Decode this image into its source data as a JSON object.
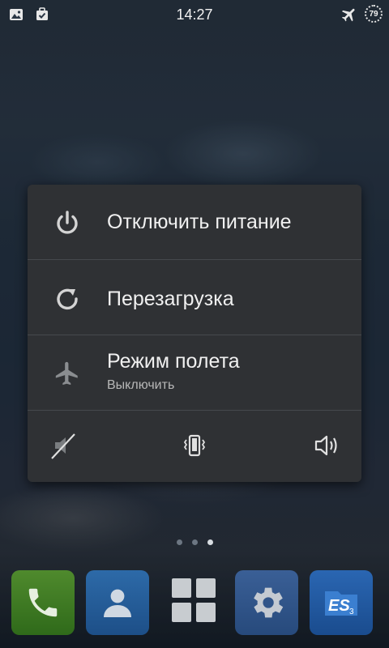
{
  "status_bar": {
    "time": "14:27",
    "battery_level": "79",
    "left_icons": [
      "gallery-notification-icon",
      "task-notification-icon"
    ],
    "right_icons": [
      "airplane-mode-icon",
      "battery-icon"
    ]
  },
  "power_menu": {
    "items": [
      {
        "label": "Отключить питание",
        "icon": "power-icon"
      },
      {
        "label": "Перезагрузка",
        "icon": "reboot-icon"
      },
      {
        "label": "Режим полета",
        "sublabel": "Выключить",
        "icon": "airplane-icon"
      }
    ],
    "sound_modes": [
      {
        "name": "silent",
        "icon": "sound-off-icon"
      },
      {
        "name": "vibrate",
        "icon": "vibrate-icon"
      },
      {
        "name": "sound-on",
        "icon": "volume-icon"
      }
    ]
  },
  "home": {
    "page_indicator": {
      "count": 3,
      "active_index": 2
    },
    "dock": [
      {
        "name": "Phone",
        "icon": "phone-icon",
        "color": "#3f7d24"
      },
      {
        "name": "Contacts",
        "icon": "contacts-icon",
        "color": "#2560a0"
      },
      {
        "name": "App drawer",
        "icon": "app-drawer-icon",
        "color": "#c8ccd0"
      },
      {
        "name": "Settings",
        "icon": "settings-gear-icon",
        "color": "#31558a"
      },
      {
        "name": "ES File Explorer",
        "icon": "es-file-explorer-icon",
        "color": "#2260a8"
      }
    ]
  },
  "colors": {
    "dialog_bg": "#2f3134",
    "divider": "#46494d",
    "text_primary": "#f0f0f0",
    "text_secondary": "#b8b8b8"
  }
}
